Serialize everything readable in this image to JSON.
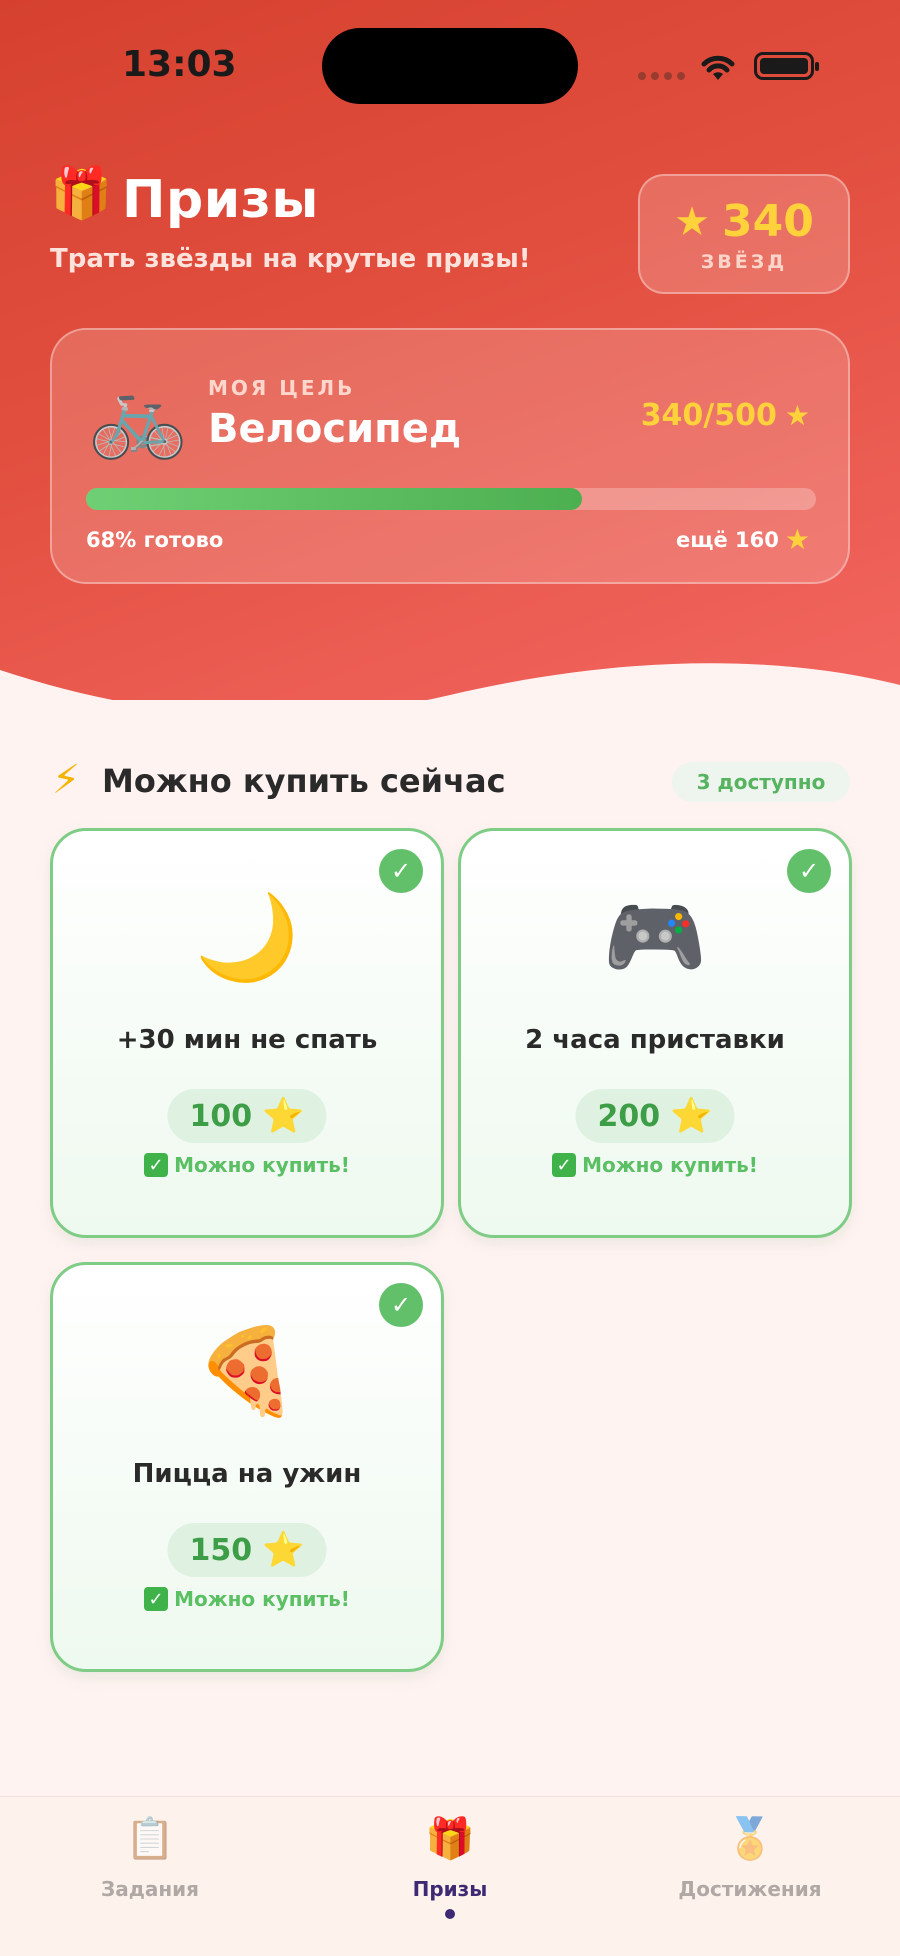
{
  "status_bar": {
    "time": "13:03"
  },
  "header": {
    "title_emoji": "🎁",
    "title": "Призы",
    "subtitle": "Трать звёзды на крутые призы!",
    "stars": {
      "count": "340",
      "label": "ЗВЁЗД"
    }
  },
  "goal": {
    "emoji": "🚲",
    "label": "МОЯ ЦЕЛЬ",
    "name": "Велосипед",
    "progress_text": "340/500",
    "progress_fraction": 0.68,
    "percent_text": "68% готово",
    "remaining_text": "ещё 160"
  },
  "section": {
    "icon": "⚡",
    "title": "Можно купить сейчас",
    "badge": "3 доступно"
  },
  "prizes": [
    {
      "emoji": "🌙",
      "name": "+30 мин не спать",
      "price": "100",
      "status": "Можно купить!"
    },
    {
      "emoji": "🎮",
      "name": "2 часа приставки",
      "price": "200",
      "status": "Можно купить!"
    },
    {
      "emoji": "🍕",
      "name": "Пицца на ужин",
      "price": "150",
      "status": "Можно купить!"
    }
  ],
  "tabs": [
    {
      "icon": "📋",
      "label": "Задания"
    },
    {
      "icon": "🎁",
      "label": "Призы"
    },
    {
      "icon": "🏅",
      "label": "Достижения"
    }
  ],
  "colors": {
    "header_start": "#d6412f",
    "header_end": "#f26660",
    "star_yellow": "#ffd23c",
    "success_green": "#62bf6a",
    "active_tab": "#3d2a73"
  }
}
